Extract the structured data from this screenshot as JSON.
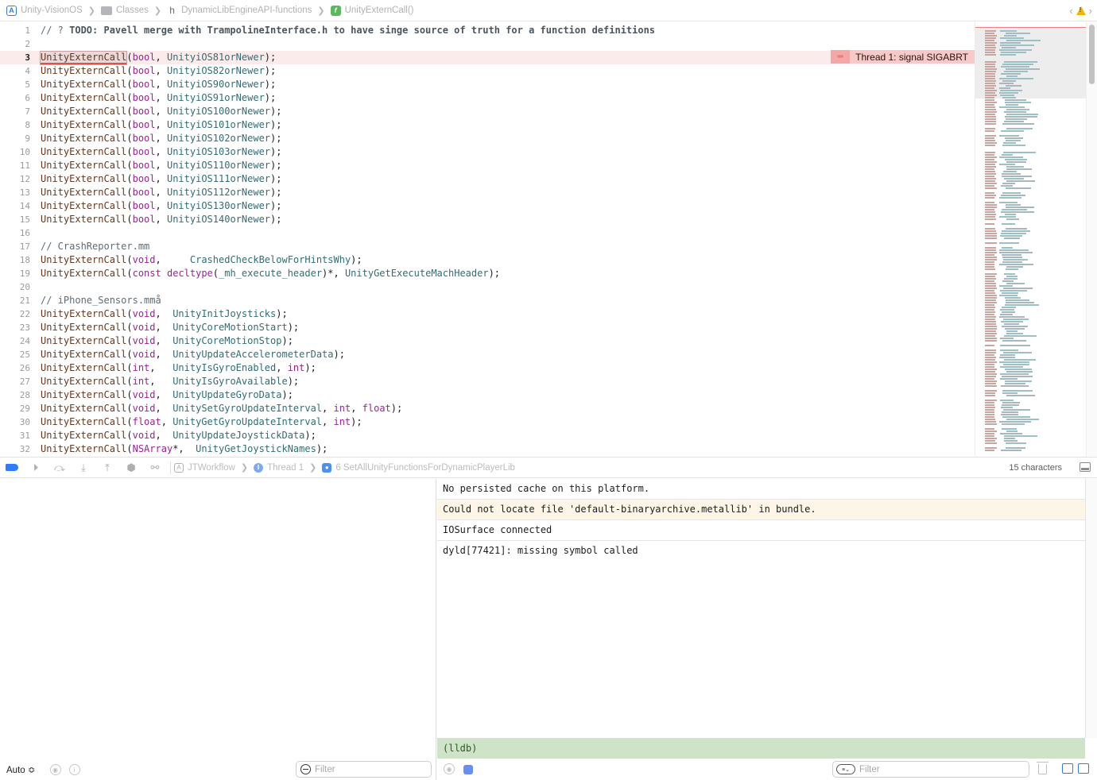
{
  "jumpbar": {
    "crumbs": [
      {
        "icon": "xcode-project-icon",
        "label": "Unity-VisionOS"
      },
      {
        "icon": "folder-icon",
        "label": "Classes"
      },
      {
        "icon": "header-file-icon",
        "label": "DynamicLibEngineAPI-functions"
      },
      {
        "icon": "function-icon",
        "label": "UnityExternCall()"
      }
    ],
    "warning_icon": "warning-icon"
  },
  "editor": {
    "error_annotation": "Thread 1: signal SIGABRT",
    "lines": [
      {
        "n": "1",
        "text": "// ? TODO: Pavell merge with TrampolineInterface.h to have singe source of truth for a function definitions"
      },
      {
        "n": "2",
        "text": ""
      },
      {
        "n": "3",
        "text": "UnityExternCall(bool, UnityiOS81orNewer);"
      },
      {
        "n": "4",
        "text": "UnityExternCall(bool, UnityiOS82orNewer);"
      },
      {
        "n": "5",
        "text": "UnityExternCall(bool, UnityiOS90orNewer);"
      },
      {
        "n": "6",
        "text": "UnityExternCall(bool, UnityiOS91orNewer);"
      },
      {
        "n": "7",
        "text": "UnityExternCall(bool, UnityiOS100orNewer);"
      },
      {
        "n": "8",
        "text": "UnityExternCall(bool, UnityiOS101orNewer);"
      },
      {
        "n": "9",
        "text": "UnityExternCall(bool, UnityiOS102orNewer);"
      },
      {
        "n": "10",
        "text": "UnityExternCall(bool, UnityiOS103orNewer);"
      },
      {
        "n": "11",
        "text": "UnityExternCall(bool, UnityiOS110orNewer);"
      },
      {
        "n": "12",
        "text": "UnityExternCall(bool, UnityiOS111orNewer);"
      },
      {
        "n": "13",
        "text": "UnityExternCall(bool, UnityiOS112orNewer);"
      },
      {
        "n": "14",
        "text": "UnityExternCall(bool, UnityiOS130orNewer);"
      },
      {
        "n": "15",
        "text": "UnityExternCall(bool, UnityiOS140orNewer);"
      },
      {
        "n": "16",
        "text": ""
      },
      {
        "n": "17",
        "text": "// CrashReporter.mm"
      },
      {
        "n": "18",
        "text": "UnityExternCall(void,     CrashedCheckBelowForHintsWhy);"
      },
      {
        "n": "19",
        "text": "UnityExternCall(const decltype(_mh_execute_header)*, UnityGetExecuteMachHeader);"
      },
      {
        "n": "20",
        "text": ""
      },
      {
        "n": "21",
        "text": "// iPhone_Sensors.mmå"
      },
      {
        "n": "22",
        "text": "UnityExternCall(void,  UnityInitJoysticks);"
      },
      {
        "n": "23",
        "text": "UnityExternCall(void,  UnityCoreMotionStart);"
      },
      {
        "n": "24",
        "text": "UnityExternCall(void,  UnityCoreMotionStop);"
      },
      {
        "n": "25",
        "text": "UnityExternCall(void,  UnityUpdateAccelerometerData);"
      },
      {
        "n": "26",
        "text": "UnityExternCall(int,   UnityIsGyroEnabled, int);"
      },
      {
        "n": "27",
        "text": "UnityExternCall(int,   UnityIsGyroAvailable);"
      },
      {
        "n": "28",
        "text": "UnityExternCall(void,  UnityUpdateGyroData);"
      },
      {
        "n": "29",
        "text": "UnityExternCall(void,  UnitySetGyroUpdateInterval, int, float);"
      },
      {
        "n": "30",
        "text": "UnityExternCall(float, UnityGetGyroUpdateInterval, int);"
      },
      {
        "n": "31",
        "text": "UnityExternCall(void,  UnityUpdateJoystickData);"
      },
      {
        "n": "32",
        "text": "UnityExternCall(NSArray*,  UnityGetJoystickNames);"
      }
    ]
  },
  "debugbar": {
    "crumbs": [
      {
        "icon": "app-icon",
        "label": "JTWorkflow"
      },
      {
        "icon": "thread-icon",
        "label": "Thread 1"
      },
      {
        "icon": "user-frame-icon",
        "label": "6 SetAllUnityFunctionsForDynamicPlayerLib"
      }
    ],
    "char_count": "15 characters"
  },
  "variables": {
    "scope": "Auto ≎",
    "filter_placeholder": "Filter"
  },
  "console": {
    "lines": [
      {
        "text": "No persisted cache on this platform.",
        "kind": "info"
      },
      {
        "text": "Could not locate file 'default-binaryarchive.metallib' in bundle.",
        "kind": "warning"
      },
      {
        "text": "IOSurface connected",
        "kind": "info"
      },
      {
        "text": "dyld[77421]: missing symbol called",
        "kind": "info"
      }
    ],
    "prompt": "(lldb)",
    "filter_placeholder": "Filter"
  },
  "colors": {
    "keyword": "#9b2393",
    "function": "#326d74",
    "macro": "#643820",
    "error_bg": "#fcebeb",
    "lldb_bg": "#cfe3c9",
    "accent": "#2f7cf6"
  }
}
